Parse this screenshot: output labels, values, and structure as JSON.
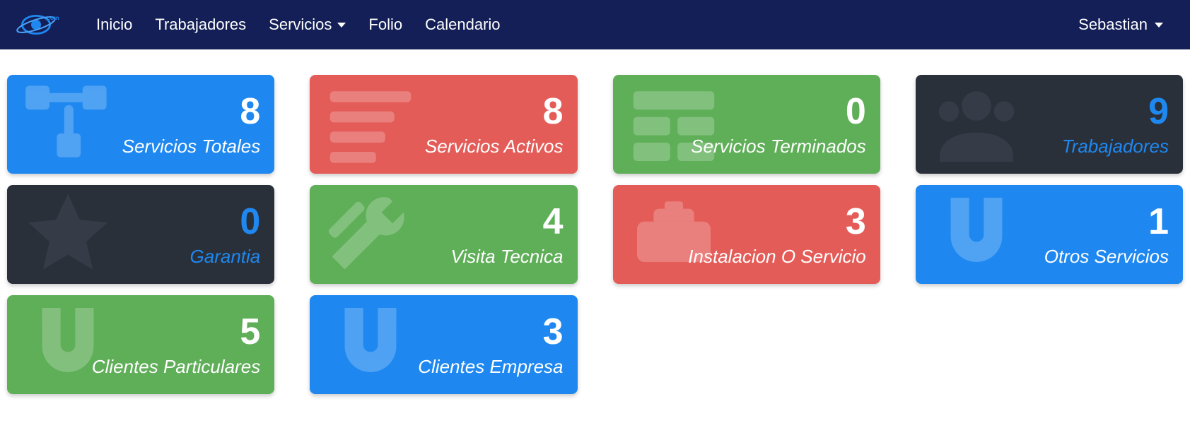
{
  "nav": {
    "inicio": "Inicio",
    "trabajadores": "Trabajadores",
    "servicios": "Servicios",
    "folio": "Folio",
    "calendario": "Calendario",
    "user": "Sebastian"
  },
  "cards": {
    "servicios_totales": {
      "value": "8",
      "label": "Servicios Totales"
    },
    "servicios_activos": {
      "value": "8",
      "label": "Servicios Activos"
    },
    "servicios_terminados": {
      "value": "0",
      "label": "Servicios Terminados"
    },
    "trabajadores": {
      "value": "9",
      "label": "Trabajadores"
    },
    "garantia": {
      "value": "0",
      "label": "Garantia"
    },
    "visita_tecnica": {
      "value": "4",
      "label": "Visita Tecnica"
    },
    "instalacion": {
      "value": "3",
      "label": "Instalacion O Servicio"
    },
    "otros_servicios": {
      "value": "1",
      "label": "Otros Servicios"
    },
    "clientes_particulares": {
      "value": "5",
      "label": "Clientes Particulares"
    },
    "clientes_empresa": {
      "value": "3",
      "label": "Clientes Empresa"
    }
  },
  "colors": {
    "navbar": "#131f56",
    "blue": "#1e88f0",
    "red": "#e45c58",
    "green": "#5fae58",
    "dark": "#2a303a"
  }
}
